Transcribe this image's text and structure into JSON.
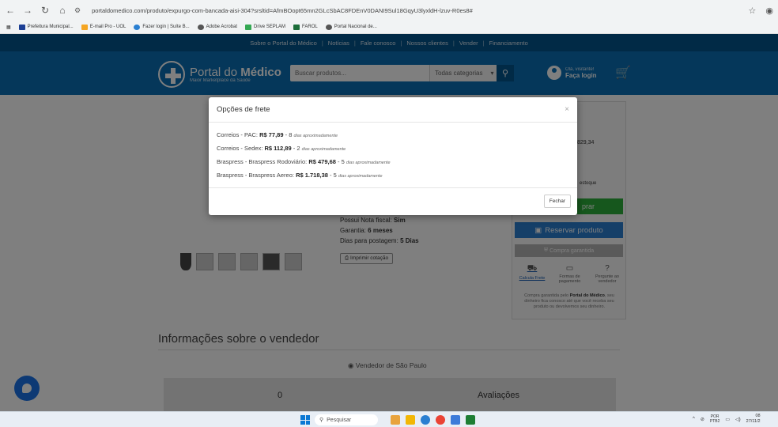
{
  "browser": {
    "url": "portaldomedico.com/produto/expurgo-com-bancada-aisi-304?srsltid=AfmBOopt65mn2GLcSbAC8FDEnV0DANI9Sul18GqyU3lyxldH-lzuv-R0es8#",
    "bookmarks": [
      "Prefeitura Municipal...",
      "E-mail Pro - UOL",
      "Fazer login | Suíte B...",
      "Adobe Acrobat",
      "Drive SEPLAM",
      "FAROL",
      "Portal Nacional de..."
    ]
  },
  "site": {
    "topnav": [
      "Sobre o Portal do Médico",
      "Notícias",
      "Fale conosco",
      "Nossos clientes",
      "Vender",
      "Financiamento"
    ],
    "logo_name_light": "Portal do",
    "logo_name_bold": "Médico",
    "logo_tagline": "Maior Marketplace da Saúde",
    "search_placeholder": "Buscar produtos...",
    "search_category": "Todas categorias",
    "user_greeting": "Olá, visitante!",
    "user_login": "Faça login",
    "cart_count": "0"
  },
  "product": {
    "info_lines": [
      {
        "label": "Possui Nota fiscal:",
        "value": "Sim"
      },
      {
        "label": "Garantia:",
        "value": "6 meses"
      },
      {
        "label": "Dias para postagem:",
        "value": "5 Dias"
      }
    ],
    "print_label": "Imprimir cotação",
    "price_fragment": "829,34",
    "qty_plus": "+",
    "stock_fragment": "estoque",
    "buy_fragment": "prar",
    "reserve_label": "Reservar produto",
    "guarantee_label": "Compra garantida",
    "actions": [
      {
        "label": "Calcula Frete",
        "icon": "truck-icon"
      },
      {
        "label": "Formas de pagamento",
        "icon": "card-icon"
      },
      {
        "label": "Pergunte ao vendedor",
        "icon": "question-icon"
      }
    ],
    "promise_pre": "Compra garantida pelo",
    "promise_bold": "Portal do Médico",
    "promise_post": ", seu dinheiro fica conosco até que você receba seu produto ou devolvemos seu dinheiro."
  },
  "seller": {
    "heading": "Informações sobre o vendedor",
    "location": "Vendedor de São Paulo",
    "count": "0",
    "ratings_label": "Avaliações"
  },
  "modal": {
    "title": "Opções de frete",
    "close_symbol": "×",
    "options": [
      {
        "name": "Correios - PAC:",
        "price": "R$ 77,89",
        "days": "8",
        "note": "dias aproximadamente"
      },
      {
        "name": "Correios - Sedex:",
        "price": "R$ 112,89",
        "days": "2",
        "note": "dias aproximadamente"
      },
      {
        "name": "Braspress - Braspress Rodoviário:",
        "price": "R$ 479,68",
        "days": "5",
        "note": "dias aproximadamente"
      },
      {
        "name": "Braspress - Braspress Aereo:",
        "price": "R$ 1.718,38",
        "days": "5",
        "note": "dias aproximadamente"
      }
    ],
    "close_button": "Fechar"
  },
  "taskbar": {
    "search_label": "Pesquisar",
    "lang_top": "POR",
    "lang_bottom": "PTB2",
    "time": "08",
    "date": "27/11/2"
  },
  "colors": {
    "site_header": "#0a6fb5",
    "site_topnav": "#02548c",
    "buy_green": "#2dae3b",
    "reserve_blue": "#2a7fd1"
  }
}
